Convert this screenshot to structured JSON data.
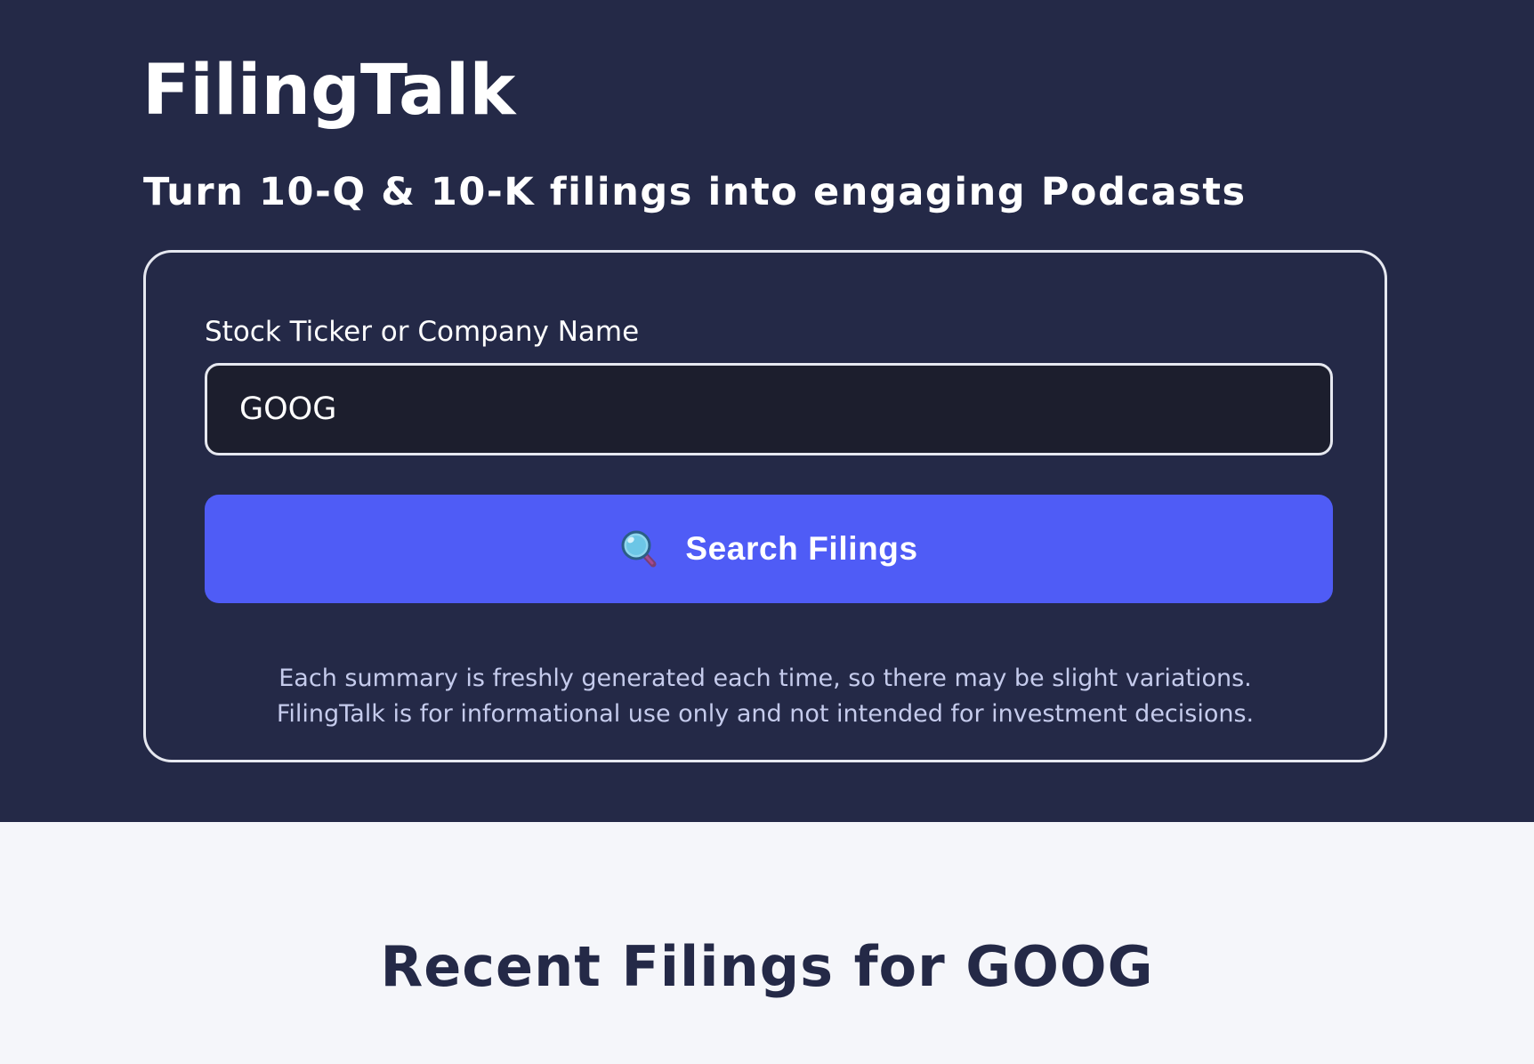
{
  "app": {
    "title": "FilingTalk",
    "tagline": "Turn 10-Q & 10-K filings into engaging Podcasts"
  },
  "search": {
    "label": "Stock Ticker or Company Name",
    "value": "GOOG",
    "placeholder": "",
    "button_label": "Search Filings",
    "button_icon": "magnifying-glass-icon"
  },
  "disclaimer": {
    "line1": "Each summary is freshly generated each time, so there may be slight variations.",
    "line2": "FilingTalk is for informational use only and not intended for investment decisions."
  },
  "results": {
    "title": "Recent Filings for GOOG"
  },
  "colors": {
    "hero_background": "#242947",
    "input_background": "#1c1e2d",
    "button_accent": "#4f5cf6",
    "page_background": "#f5f6fa",
    "disclaimer_text": "#c5cbec"
  }
}
